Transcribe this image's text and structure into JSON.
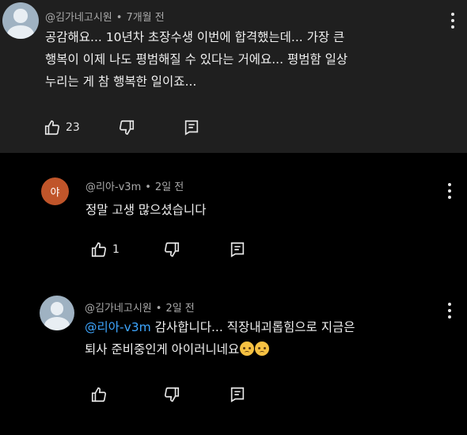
{
  "comments": [
    {
      "author": "@김가네고시원",
      "time": "7개월 전",
      "lines": [
        "공감해요... 10년차 초장수생 이번에 합격했는데... 가장 큰",
        "행복이 이제 나도 평범해질 수 있다는 거에요... 평범함 일상",
        "누리는 게 참 행복한 일이죠..."
      ],
      "likes": "23",
      "avatar_icon": "default-avatar-icon"
    },
    {
      "author": "@리아-v3m",
      "time": "2일 전",
      "avatar_letter": "야",
      "avatar_color": "#c0552a",
      "lines": [
        "정말 고생 많으셨습니다"
      ],
      "likes": "1"
    },
    {
      "author": "@김가네고시원",
      "time": "2일 전",
      "mention": "@리아-v3m",
      "line1_rest": " 감사합니다... 직장내괴롭힘으로 지금은",
      "line2": "퇴사 준비중인게 아이러니네요",
      "emojis": [
        "pleading-face-emoji",
        "pleading-face-emoji"
      ],
      "avatar_icon": "default-avatar-icon"
    }
  ],
  "meta_separator": "•",
  "colors": {
    "mention": "#3ea6ff",
    "thread_background": "#1f1f1f",
    "reply_background": "#000000"
  }
}
